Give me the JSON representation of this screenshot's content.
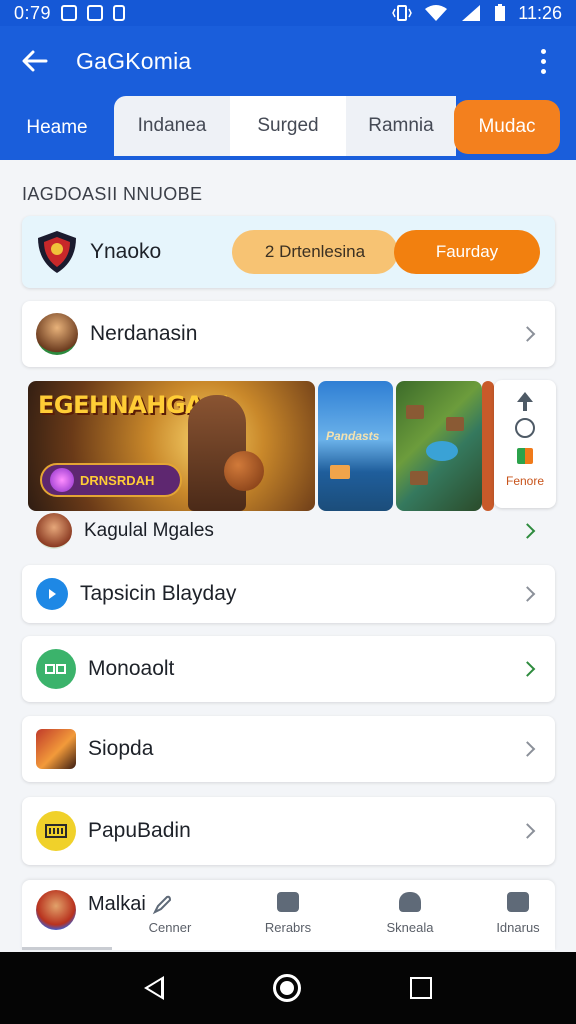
{
  "status_bar": {
    "time": "0:79",
    "clock": "11:26"
  },
  "app_bar": {
    "title": "GaGKomia"
  },
  "tabs": [
    {
      "label": "Heame"
    },
    {
      "label": "Indanea"
    },
    {
      "label": "Surged"
    },
    {
      "label": "Ramnia"
    },
    {
      "label": "Mudac"
    }
  ],
  "section_label": "IAGDOASII NNUOBE",
  "featured": {
    "name": "Ynaoko",
    "pill_left": "2 Drtenlesina",
    "pill_right": "Faurday"
  },
  "list": [
    {
      "label": "Nerdanasin"
    },
    {
      "label": "Kagulal Mgales"
    },
    {
      "label": "Tapsicin Blayday"
    },
    {
      "label": "Monoaolt"
    },
    {
      "label": "Siopda"
    },
    {
      "label": "PapuBadin"
    }
  ],
  "banners": {
    "main_title": "EGEHNAHGA Z",
    "main_badge": "DRNSRDAH",
    "second_caption": "Pandasts",
    "side_label": "Fenore"
  },
  "bottom_nav": {
    "first": "Malkai",
    "items": [
      {
        "label": "Cenner"
      },
      {
        "label": "Rerabrs"
      },
      {
        "label": "Skneala"
      },
      {
        "label": "Idnarus"
      }
    ]
  },
  "colors": {
    "primary": "#1a5edb",
    "accent": "#f3801e",
    "featured_bg": "#e6f5fc"
  },
  "icons": [
    "back-arrow-icon",
    "more-vert-icon",
    "wifi-icon",
    "signal-icon",
    "battery-icon",
    "chevron-right-icon",
    "arrow-up-icon",
    "circle-icon"
  ]
}
